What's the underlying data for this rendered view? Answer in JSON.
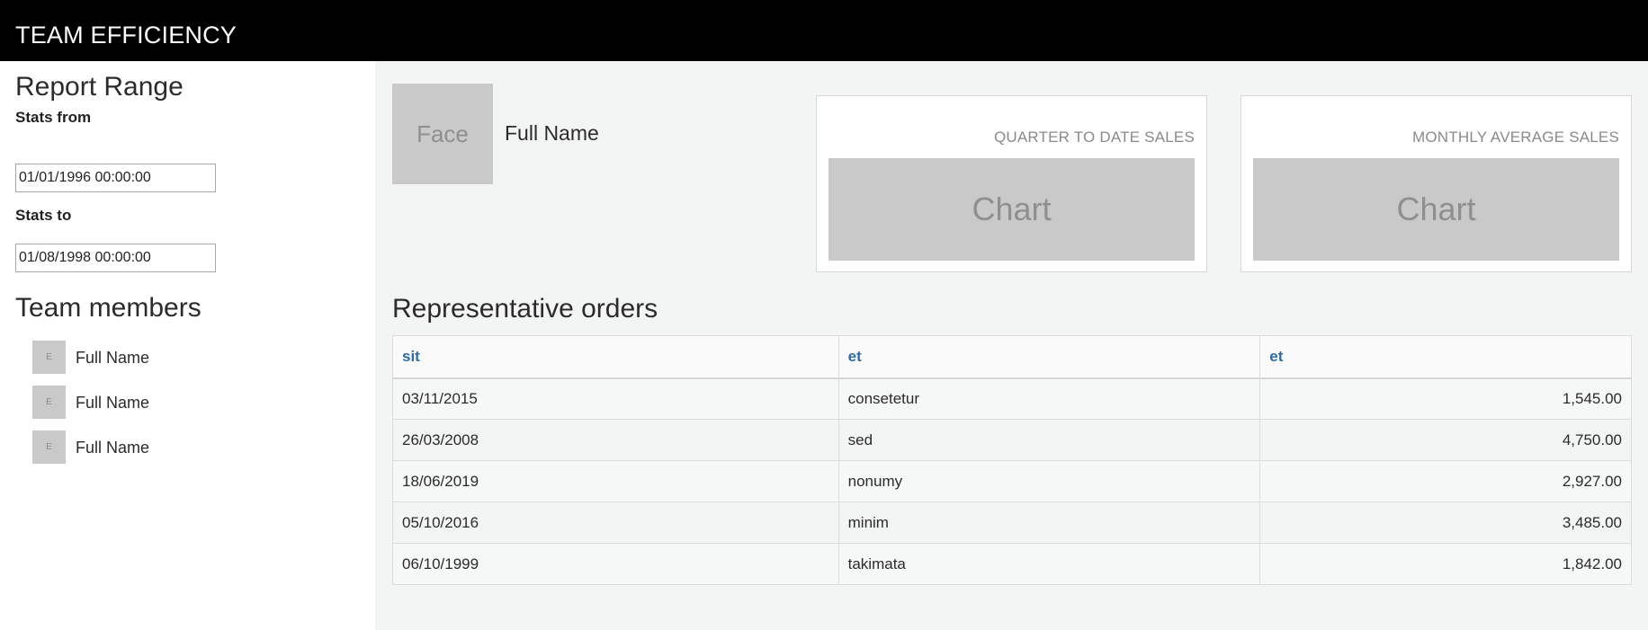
{
  "header": {
    "title": "TEAM EFFICIENCY"
  },
  "sidebar": {
    "report_range_heading": "Report Range",
    "stats_from_label": "Stats from",
    "stats_from_value": "01/01/1996 00:00:00",
    "stats_to_label": "Stats to",
    "stats_to_value": "01/08/1998 00:00:00",
    "team_heading": "Team members",
    "members": [
      {
        "avatar": "E",
        "name": "Full Name"
      },
      {
        "avatar": "E",
        "name": "Full Name"
      },
      {
        "avatar": "E",
        "name": "Full Name"
      }
    ]
  },
  "profile": {
    "face_placeholder": "Face",
    "name": "Full Name"
  },
  "cards": [
    {
      "title": "QUARTER TO DATE SALES",
      "chart_placeholder": "Chart"
    },
    {
      "title": "MONTHLY AVERAGE SALES",
      "chart_placeholder": "Chart"
    }
  ],
  "orders": {
    "title": "Representative orders",
    "columns": [
      "sit",
      "et",
      "et"
    ],
    "rows": [
      [
        "03/11/2015",
        "consetetur",
        "1,545.00"
      ],
      [
        "26/03/2008",
        "sed",
        "4,750.00"
      ],
      [
        "18/06/2019",
        "nonumy",
        "2,927.00"
      ],
      [
        "05/10/2016",
        "minim",
        "3,485.00"
      ],
      [
        "06/10/1999",
        "takimata",
        "1,842.00"
      ]
    ]
  }
}
